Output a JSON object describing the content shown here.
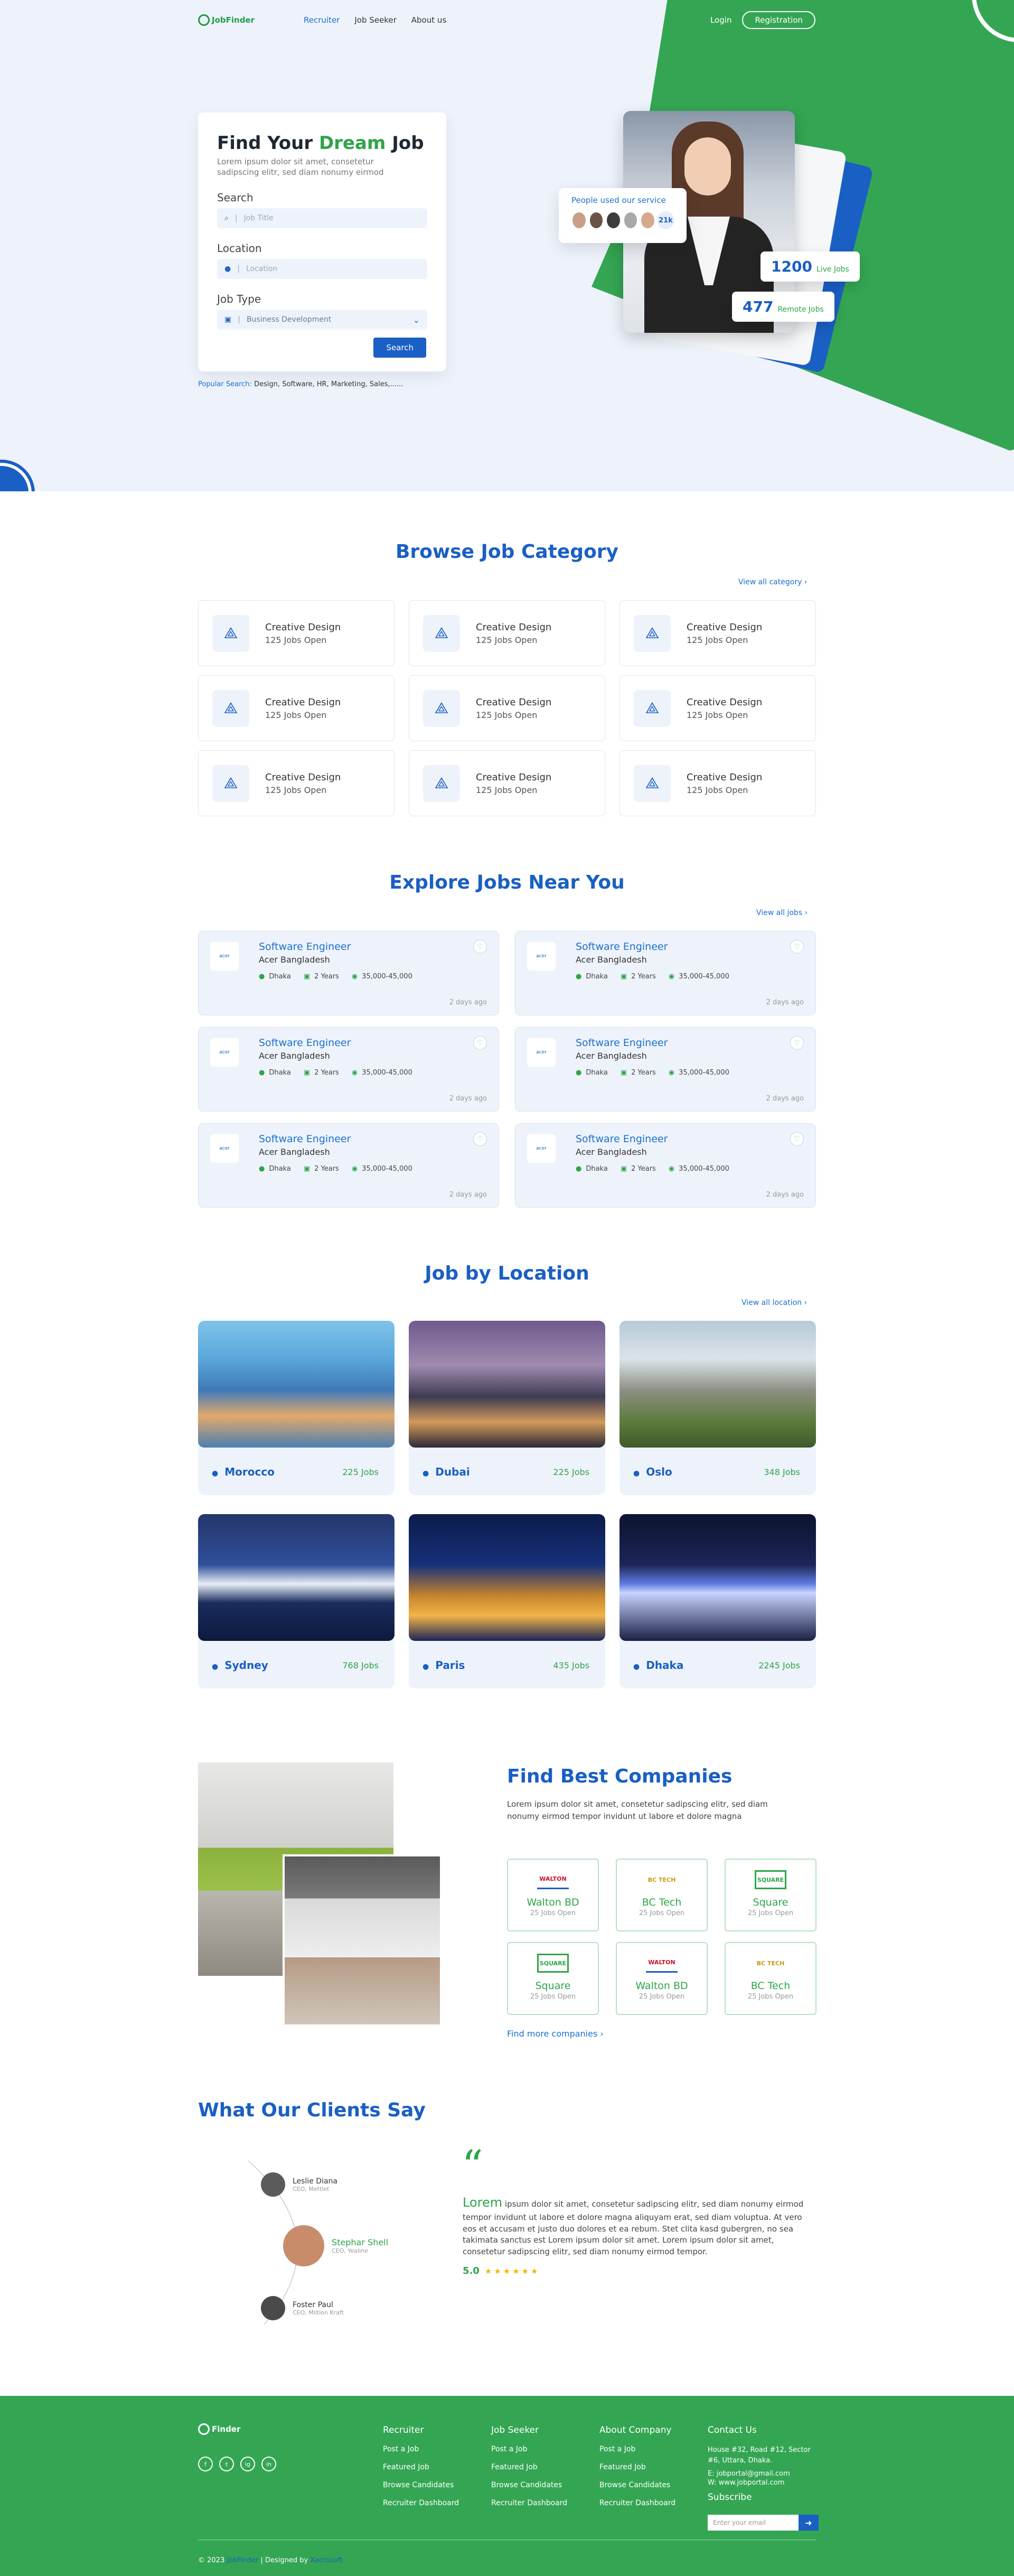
{
  "nav": {
    "logo": "JobFinder",
    "links": [
      "Recruiter",
      "Job Seeker",
      "About us"
    ],
    "login": "Login",
    "registration": "Registration"
  },
  "hero": {
    "title_pre": "Find Your",
    "title_accent": "Dream",
    "title_post": "Job",
    "subtitle": "Lorem ipsum dolor sit amet, consetetur sadipscing elitr, sed diam nonumy eirmod",
    "search_label": "Search",
    "search_placeholder": "Job Title",
    "location_label": "Location",
    "location_placeholder": "Location",
    "jobtype_label": "Job Type",
    "jobtype_value": "Business Development",
    "search_button": "Search",
    "popular_label": "Popular Search:",
    "popular_value": "Design, Software, HR, Marketing, Sales,......",
    "used_title": "People used our service",
    "used_count": "21k",
    "live_jobs_num": "1200",
    "live_jobs_label": "Live Jobs",
    "remote_jobs_num": "477",
    "remote_jobs_label": "Remote Jobs"
  },
  "categories": {
    "title": "Browse Job Category",
    "view_all": "View all category",
    "items": [
      {
        "name": "Creative Design",
        "count": "125 Jobs Open"
      },
      {
        "name": "Creative Design",
        "count": "125 Jobs Open"
      },
      {
        "name": "Creative Design",
        "count": "125 Jobs Open"
      },
      {
        "name": "Creative Design",
        "count": "125 Jobs Open"
      },
      {
        "name": "Creative Design",
        "count": "125 Jobs Open"
      },
      {
        "name": "Creative Design",
        "count": "125 Jobs Open"
      },
      {
        "name": "Creative Design",
        "count": "125 Jobs Open"
      },
      {
        "name": "Creative Design",
        "count": "125 Jobs Open"
      },
      {
        "name": "Creative Design",
        "count": "125 Jobs Open"
      }
    ]
  },
  "jobs": {
    "title": "Explore Jobs Near You",
    "view_all": "View all jobs",
    "items": [
      {
        "title": "Software Engineer",
        "company": "Acer Bangladesh",
        "location": "Dhaka",
        "exp": "2 Years",
        "salary": "35,000-45,000",
        "ago": "2 days ago"
      },
      {
        "title": "Software Engineer",
        "company": "Acer Bangladesh",
        "location": "Dhaka",
        "exp": "2 Years",
        "salary": "35,000-45,000",
        "ago": "2 days ago"
      },
      {
        "title": "Software Engineer",
        "company": "Acer Bangladesh",
        "location": "Dhaka",
        "exp": "2 Years",
        "salary": "35,000-45,000",
        "ago": "2 days ago"
      },
      {
        "title": "Software Engineer",
        "company": "Acer Bangladesh",
        "location": "Dhaka",
        "exp": "2 Years",
        "salary": "35,000-45,000",
        "ago": "2 days ago"
      },
      {
        "title": "Software Engineer",
        "company": "Acer Bangladesh",
        "location": "Dhaka",
        "exp": "2 Years",
        "salary": "35,000-45,000",
        "ago": "2 days ago"
      },
      {
        "title": "Software Engineer",
        "company": "Acer Bangladesh",
        "location": "Dhaka",
        "exp": "2 Years",
        "salary": "35,000-45,000",
        "ago": "2 days ago"
      }
    ]
  },
  "locations": {
    "title": "Job by Location",
    "view_all": "View all location",
    "items": [
      {
        "name": "Morocco",
        "jobs": "225 Jobs"
      },
      {
        "name": "Dubai",
        "jobs": "225 Jobs"
      },
      {
        "name": "Oslo",
        "jobs": "348 Jobs"
      },
      {
        "name": "Sydney",
        "jobs": "768 Jobs"
      },
      {
        "name": "Paris",
        "jobs": "435 Jobs"
      },
      {
        "name": "Dhaka",
        "jobs": "2245 Jobs"
      }
    ]
  },
  "companies": {
    "title": "Find Best Companies",
    "desc": "Lorem ipsum dolor sit amet, consetetur sadipscing elitr, sed diam nonumy eirmod tempor invidunt ut labore et dolore magna",
    "more": "Find more companies",
    "items": [
      {
        "name": "Walton BD",
        "open": "25 Jobs Open",
        "logo": "WALTON"
      },
      {
        "name": "BC Tech",
        "open": "25 Jobs Open",
        "logo": "BC TECH"
      },
      {
        "name": "Square",
        "open": "25 Jobs Open",
        "logo": "SQUARE"
      },
      {
        "name": "Square",
        "open": "25 Jobs Open",
        "logo": "SQUARE"
      },
      {
        "name": "Walton BD",
        "open": "25 Jobs Open",
        "logo": "WALTON"
      },
      {
        "name": "BC Tech",
        "open": "25 Jobs Open",
        "logo": "BC TECH"
      }
    ]
  },
  "testimonials": {
    "title": "What Our Clients Say",
    "clients": [
      {
        "name": "Leslie Diana",
        "role": "CEO, Mettlet"
      },
      {
        "name": "Stephar Shell",
        "role": "CEO, Yealine"
      },
      {
        "name": "Foster Paul",
        "role": "CEO, Miltion Kraft"
      }
    ],
    "quote_lead": "Lorem",
    "quote": "ipsum dolor sit amet, consetetur sadipscing elitr, sed diam nonumy eirmod tempor invidunt ut labore et dolore magna aliquyam erat, sed diam voluptua. At vero eos et accusam et justo duo dolores et ea rebum. Stet clita kasd gubergren, no sea takimata sanctus est Lorem ipsum dolor sit amet. Lorem ipsum dolor sit amet, consetetur sadipscing elitr, sed diam nonumy eirmod tempor.",
    "rating": "5.0",
    "stars": "★★★★★★"
  },
  "footer": {
    "logo": "Finder",
    "social": [
      "f",
      "t",
      "ig",
      "in"
    ],
    "recruiter_title": "Recruiter",
    "recruiter_links": [
      "Post a Job",
      "Featured Job",
      "Browse Candidates",
      "Recruiter Dashboard"
    ],
    "seeker_title": "Job Seeker",
    "seeker_links": [
      "Post a Job",
      "Featured Job",
      "Browse Candidates",
      "Recruiter Dashboard"
    ],
    "about_title": "About Company",
    "about_links": [
      "Post a Job",
      "Featured Job",
      "Browse Candidates",
      "Recruiter Dashboard"
    ],
    "contact_title": "Contact Us",
    "address": "House #32, Road #12, Sector #6, Uttara, Dhaka.",
    "email": "E: jobportal@gmail.com",
    "web": "W: www.jobportal.com",
    "subscribe": "Subscribe",
    "email_placeholder": "Enter your email",
    "copyright_pre": "© 2023",
    "copyright_brand": "JobFinder",
    "designed_pre": "| Designed by",
    "designed_by": "Xacrosoft"
  },
  "colors": {
    "primary": "#1a5fc4",
    "green": "#34a653",
    "light": "#eef3fb"
  }
}
